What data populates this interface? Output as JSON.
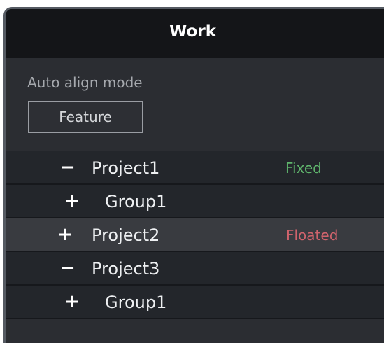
{
  "header": {
    "title": "Work"
  },
  "mode": {
    "label": "Auto align mode",
    "button_label": "Feature"
  },
  "tree": {
    "rows": [
      {
        "toggle": "−",
        "label": "Project1",
        "status": "Fixed",
        "status_color": "#5fb46c"
      },
      {
        "toggle": "+",
        "label": "Group1",
        "status": "",
        "status_color": ""
      },
      {
        "toggle": "+",
        "label": "Project2",
        "status": "Floated",
        "status_color": "#d0636c"
      },
      {
        "toggle": "−",
        "label": "Project3",
        "status": "",
        "status_color": ""
      },
      {
        "toggle": "+",
        "label": "Group1",
        "status": "",
        "status_color": ""
      }
    ]
  },
  "colors": {
    "header_bg": "#141518",
    "panel_bg": "#2b2d32",
    "row_bg": "#23262b",
    "row_selected_bg": "#393b40"
  }
}
